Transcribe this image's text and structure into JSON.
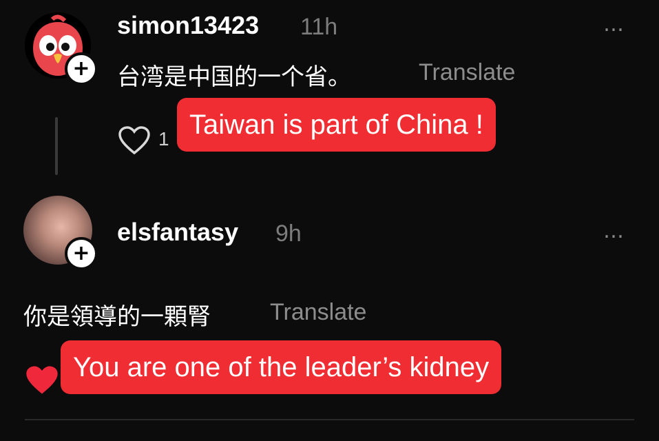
{
  "comments": [
    {
      "username": "simon13423",
      "time": "11h",
      "text": "台湾是中国的一个省。",
      "translate_label": "Translate",
      "like_count": "1",
      "more_icon": "…"
    },
    {
      "username": "elsfantasy",
      "time": "9h",
      "text": "你是領導的一顆腎",
      "translate_label": "Translate",
      "more_icon": "…"
    }
  ],
  "overlays": [
    {
      "text": "Taiwan is part of China !"
    },
    {
      "text": "You are one of the leader’s kidney"
    }
  ],
  "colors": {
    "background": "#0c0c0d",
    "overlay_red": "#f02d32",
    "liked_heart": "#f0283c",
    "muted_text": "#8d8d8d"
  },
  "icons": {
    "follow_plus": "+",
    "heart": "heart-icon",
    "liked_heart": "heart-filled-icon"
  }
}
